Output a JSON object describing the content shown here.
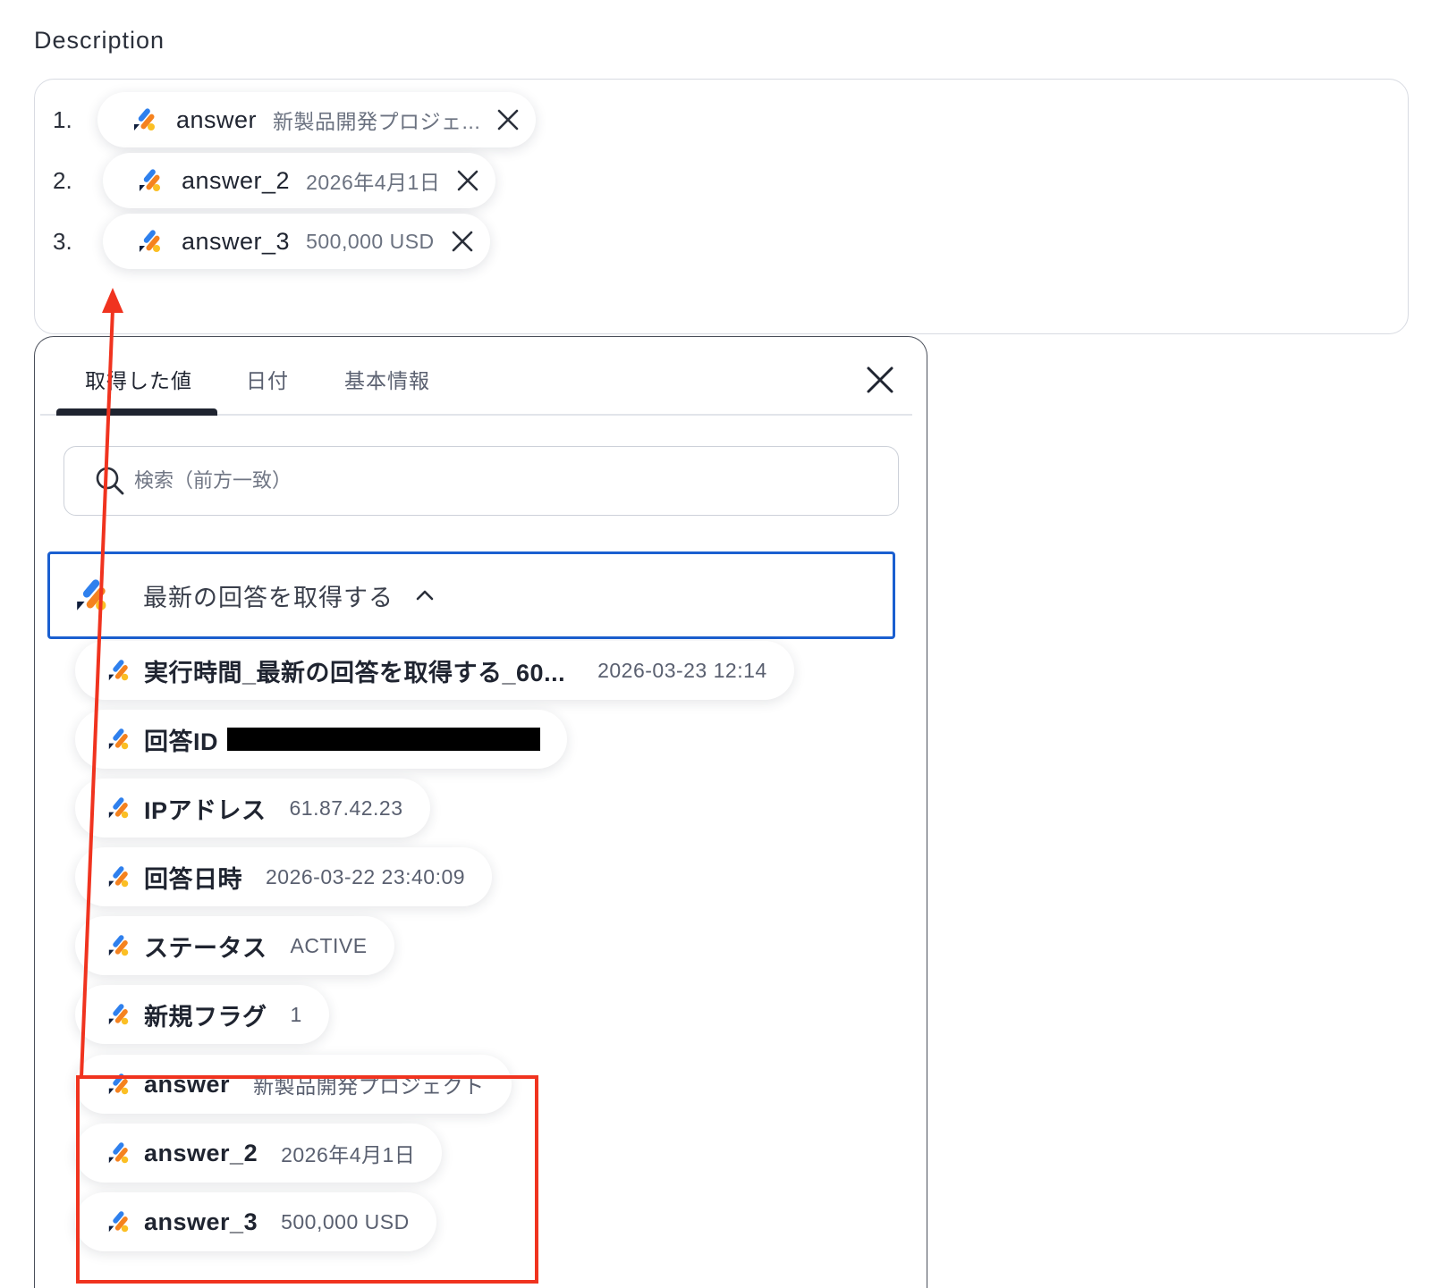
{
  "description": {
    "label": "Description",
    "rows": [
      {
        "index": "1.",
        "name": "answer",
        "value": "新製品開発プロジェ..."
      },
      {
        "index": "2.",
        "name": "answer_2",
        "value": "2026年4月1日"
      },
      {
        "index": "3.",
        "name": "answer_3",
        "value": "500,000 USD"
      }
    ]
  },
  "panel": {
    "tabs": [
      {
        "label": "取得した値",
        "active": true
      },
      {
        "label": "日付",
        "active": false
      },
      {
        "label": "基本情報",
        "active": false
      }
    ],
    "search": {
      "placeholder": "検索（前方一致）",
      "value": ""
    },
    "group": {
      "label": "最新の回答を取得する",
      "expanded": true,
      "items": [
        {
          "name": "実行時間_最新の回答を取得する_60...",
          "value": "2026-03-23 12:14"
        },
        {
          "name": "回答ID",
          "value": "",
          "redacted": true
        },
        {
          "name": "IPアドレス",
          "value": "61.87.42.23"
        },
        {
          "name": "回答日時",
          "value": "2026-03-22 23:40:09"
        },
        {
          "name": "ステータス",
          "value": "ACTIVE"
        },
        {
          "name": "新規フラグ",
          "value": "1"
        },
        {
          "name": "answer",
          "value": "新製品開発プロジェクト"
        },
        {
          "name": "answer_2",
          "value": "2026年4月1日"
        },
        {
          "name": "answer_3",
          "value": "500,000 USD"
        }
      ]
    }
  },
  "colors": {
    "annotation_red": "#f0331f",
    "group_border_blue": "#1a5fd0",
    "logo_blue": "#2f80ed",
    "logo_orange": "#f5821f",
    "logo_yellow": "#fbbf24",
    "logo_navy": "#0f1e3c"
  },
  "icons": {
    "pill_logo": "app-logo-icon",
    "remove": "close-icon",
    "search": "search-icon",
    "group_toggle": "chevron-up-icon"
  }
}
